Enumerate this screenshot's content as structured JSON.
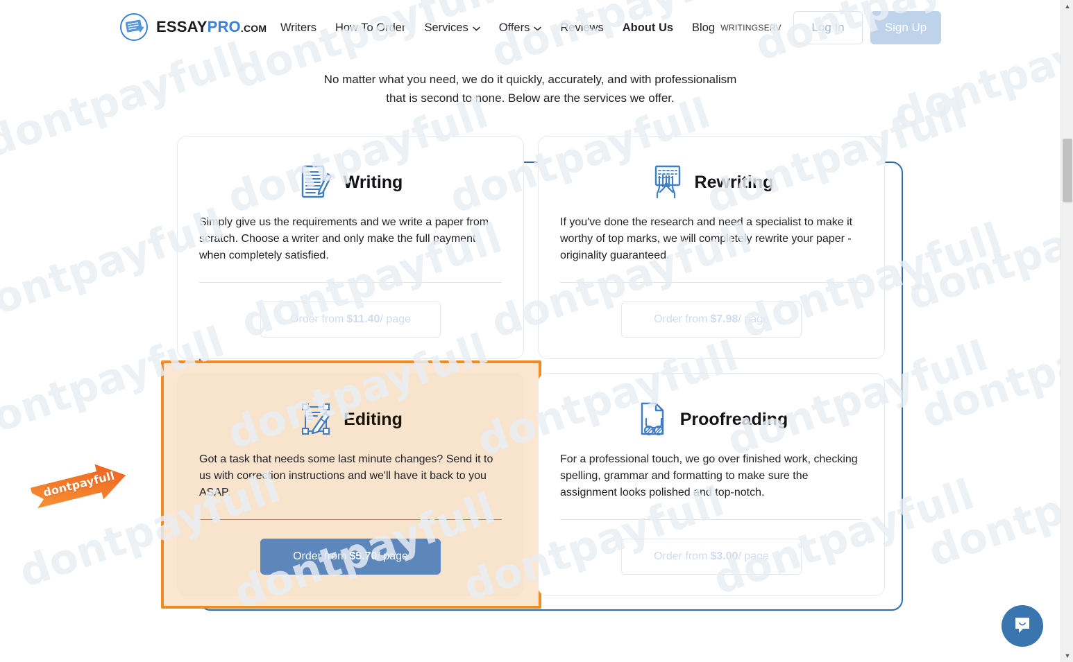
{
  "header": {
    "brand": {
      "part1": "ESSAY",
      "part2": "PRO",
      "part3": ".COM",
      "logo_icon": "essaypro-document-pencil-logo"
    },
    "nav": [
      {
        "label": "Writers",
        "has_caret": false,
        "active": false
      },
      {
        "label": "How To Order",
        "has_caret": false,
        "active": false
      },
      {
        "label": "Services",
        "has_caret": true,
        "active": false
      },
      {
        "label": "Offers",
        "has_caret": true,
        "active": false
      },
      {
        "label": "Reviews",
        "has_caret": false,
        "active": false
      },
      {
        "label": "About Us",
        "has_caret": false,
        "active": true
      },
      {
        "label": "Blog",
        "has_caret": false,
        "active": false
      }
    ],
    "account_name": "WRITINGSERV",
    "login_label": "Log In",
    "signup_label": "Sign Up"
  },
  "intro": {
    "line1": "No matter what you need, we do it quickly, accurately, and with professionalism",
    "line2": "that is second to none. Below are the services we offer."
  },
  "cards": [
    {
      "id": "writing",
      "title": "Writing",
      "icon": "document-pencil-icon",
      "description": "Simply give us the requirements and we write a paper from scratch. Choose a writer and only make the full payment when completely satisfied.",
      "cta_prefix": "Order from ",
      "cta_price": "$11.40",
      "cta_suffix": "/ page",
      "highlighted": false
    },
    {
      "id": "rewriting",
      "title": "Rewriting",
      "icon": "hands-document-icon",
      "description": "If you've done the research and need a specialist to make it worthy of top marks, we will completely rewrite your paper - originality guaranteed.",
      "cta_prefix": "Order from ",
      "cta_price": "$7.98",
      "cta_suffix": "/ page",
      "highlighted": false
    },
    {
      "id": "editing",
      "title": "Editing",
      "icon": "edit-crop-pencil-icon",
      "description": "Got a task that needs some last minute changes? Send it to us with correction instructions and we'll have it back to you ASAP.",
      "cta_prefix": "Order from ",
      "cta_price": "$5.70",
      "cta_suffix": "/ page",
      "highlighted": true
    },
    {
      "id": "proofreading",
      "title": "Proofreading",
      "icon": "document-magnifier-glasses-icon",
      "description": "For a professional touch, we go over finished work, checking spelling, grammar and formatting to make sure the assignment looks polished and top-notch.",
      "cta_prefix": "Order from ",
      "cta_price": "$3.00",
      "cta_suffix": "/ page",
      "highlighted": false
    }
  ],
  "promo_arrow": {
    "label": "dontpayfull",
    "color": "#f4701f"
  },
  "chat": {
    "icon": "chat-smile-icon",
    "color": "#3a75b0"
  },
  "watermark": {
    "text": "dontpayfull",
    "color": "#e9eef5"
  },
  "colors": {
    "brand_blue": "#3b82d6",
    "highlight_orange": "#ef8b23",
    "highlight_fill": "#fbe6d2",
    "selection_ring": "#2b6cb5",
    "active_cta": "#5d87ba"
  },
  "scrollbar": {
    "up_glyph": "▲",
    "down_glyph": "▼"
  }
}
